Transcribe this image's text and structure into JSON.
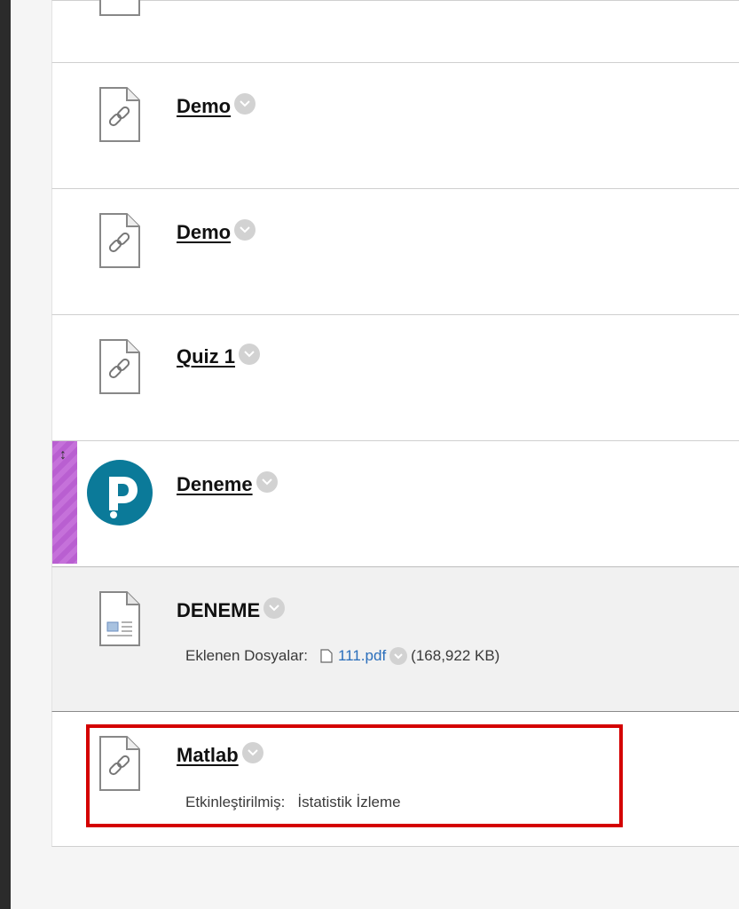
{
  "items": [
    {
      "title": "Demo"
    },
    {
      "title": "Demo"
    },
    {
      "title": "Quiz 1"
    },
    {
      "title": "Deneme",
      "icon": "pearson-logo-icon"
    },
    {
      "title": "DENEME",
      "attachments_label": "Eklenen Dosyalar:",
      "file_name": "111.pdf",
      "file_size": "(168,922 KB)"
    },
    {
      "title": "Matlab",
      "enabled_label": "Etkinleştirilmiş:",
      "enabled_value": "İstatistik İzleme"
    }
  ],
  "colors": {
    "accent_focus": "#d40000",
    "drag_handle": "#b95fd1",
    "link": "#2a6ebb",
    "pearson": "#0b7a99"
  }
}
